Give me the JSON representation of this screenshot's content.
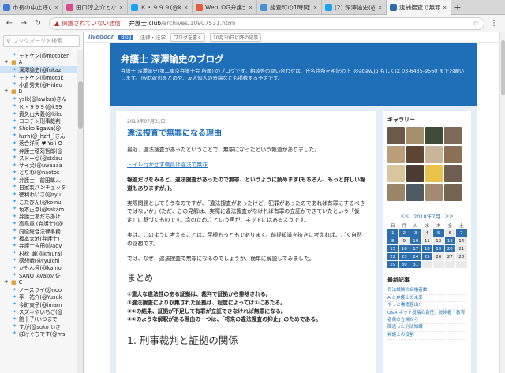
{
  "tabs": [
    {
      "label": "市長の中止呼びかけ",
      "color": "#3b7dd8"
    },
    {
      "label": "田口淳之介と小嶺麗",
      "color": "#d94b8c"
    },
    {
      "label": "Ｋ・９９９(@k999",
      "color": "#1da1f2"
    },
    {
      "label": "WebLOG弁護士中村",
      "color": "#e25d3a"
    },
    {
      "label": "能登町の1時間天気",
      "color": "#4a90d9"
    },
    {
      "label": "(2) 深澤諭史(@fuka",
      "color": "#1da1f2"
    },
    {
      "label": "逮捕捜査で無罪にな",
      "color": "#2b6cb0",
      "active": true
    },
    {
      "label": "+"
    }
  ],
  "nav": {
    "warning": "保護されていない通信",
    "host": "弁護士.club",
    "path": "/archives/10907531.html"
  },
  "sidebar": {
    "search_placeholder": "ブックマークを検索",
    "rows": [
      {
        "text": "モトケン(@motoken",
        "type": "item"
      },
      {
        "text": "A",
        "type": "folder"
      },
      {
        "text": "深澤諭史(@fukaz",
        "type": "item",
        "selected": true
      },
      {
        "text": "モトケン(@motok",
        "type": "item"
      },
      {
        "text": "小倉秀夫(@Hideo",
        "type": "item"
      },
      {
        "text": "B",
        "type": "folder"
      },
      {
        "text": "yslk(@lawkus)さん",
        "type": "item"
      },
      {
        "text": "Ｋ・９９９(@k99",
        "type": "item"
      },
      {
        "text": "資久山大義(@kiku",
        "type": "item"
      },
      {
        "text": "ヨコチン刑事裁判",
        "type": "item"
      },
      {
        "text": "Shoko Egawa(@",
        "type": "item"
      },
      {
        "text": "hzrh(@_hzrf_)さん",
        "type": "item"
      },
      {
        "text": "落合洋司 ♥ Yoji O",
        "type": "item"
      },
      {
        "text": "弁護士穂苅哲郎(@",
        "type": "item"
      },
      {
        "text": "スドー☺(@stdau",
        "type": "item"
      },
      {
        "text": "サイ犬(@uwaaaa",
        "type": "item"
      },
      {
        "text": "とりね(@naotos",
        "type": "item"
      },
      {
        "text": "弁護士　前田隼人",
        "type": "item"
      },
      {
        "text": "自家製パンチェッタ",
        "type": "item"
      },
      {
        "text": "徳利わいさ(@ryu",
        "type": "item"
      },
      {
        "text": "こたぴん(@koinuj",
        "type": "item"
      },
      {
        "text": "坂本正幸(@sakam",
        "type": "item"
      },
      {
        "text": "弁護士あだちあけ",
        "type": "item"
      },
      {
        "text": "高島章 (弁護士)(@",
        "type": "item"
      },
      {
        "text": "向原総合法律事務",
        "type": "item"
      },
      {
        "text": "橋本太地(弁護士)",
        "type": "item"
      },
      {
        "text": "弁護士吉田(@adv",
        "type": "item"
      },
      {
        "text": "村松 謙(@kmurai",
        "type": "item"
      },
      {
        "text": "感想戦(@ryuichi",
        "type": "item"
      },
      {
        "text": "かもん号(@kamo",
        "type": "item"
      },
      {
        "text": "SANO_Ayako/ 佐",
        "type": "item"
      },
      {
        "text": "C",
        "type": "folder"
      },
      {
        "text": "ノースライ(@noo",
        "type": "item"
      },
      {
        "text": "平　祐介(@Yusuk",
        "type": "item"
      },
      {
        "text": "今町東子(@imam",
        "type": "item"
      },
      {
        "text": "スズキやいちご(@",
        "type": "item"
      },
      {
        "text": "館十子(いつまで",
        "type": "item"
      },
      {
        "text": "すが(@suko_t)さ",
        "type": "item"
      },
      {
        "text": "ぽけぐちです(@ms",
        "type": "item"
      }
    ]
  },
  "livedoor": {
    "logo": "livedoor",
    "blog_tag": "Blog",
    "path": "法律・法学",
    "btn1": "ブログを書く",
    "btn2": "10月30日以降の記事"
  },
  "blog": {
    "title": "弁護士 深澤諭史のブログ",
    "desc": "弁護士 深澤諭史(第二東京弁護士会 所属) のブログです。相談等の問い合わせは、氏名住所を明記の上 i@atlaw.jp もしくは 03-6435-9560 までお願いします。Twitterのまとめや、友人知人の寄稿なども掲載する予定です。"
  },
  "post": {
    "date": "2018年07月31日",
    "title": "違法捜査で無罪になる理由",
    "p1": "最近、違法捜査があったということで、無罪になったという報道がありました。",
    "link": "トイレ行かせず職員は違法で無罪",
    "p2": "報道だけをみると、違法捜査があったので無罪、というように読めます(もちろん、もっと詳しい報道もありますが。)。",
    "p3": "実際問題としてそうなのですが、「違法捜査があったけど、犯罪があったのであれば有罪にするべきではないか」(ただ、この見解は、実際に違法捜査がなければ有罪の立証ができていたという「仮定」に基づくものです。念のため。) という声が、ネットにはあるようです。",
    "p4": "実は、このように考えることは、至極もっともであります。前提知識を抜きに考えれば、ごく自然の感想です。",
    "p5": "では、なぜ、違法捜査で無罪になるのでしょうか、簡単に解説してみました。",
    "h_summary": "まとめ",
    "summary": [
      "①重大な違法性のある証拠は、裁判で証拠から排除される。",
      "②違法捜査により収集された証拠は、程度によっては①にあたる。",
      "③①の結果、証拠が不足して有罪が立証できなければ無罪になる。",
      "④①のような解釈がある理由の一つは、「将来の違法捜査の抑止」のためである。"
    ],
    "h_section1": "1. 刑事裁判と証拠の関係"
  },
  "side": {
    "gallery_title": "ギャラリー",
    "gallery_colors": [
      "#6b5a4a",
      "#a88f6c",
      "#3e4b3a",
      "#7d6b57",
      "#b9a07a",
      "#5d4636",
      "#c8b59a",
      "#8a7055",
      "#d8c69e",
      "#4b3d33",
      "#e8c24a",
      "#6f5f52",
      "#9c8468",
      "#4e5b62",
      "#a38b73",
      "#756452"
    ],
    "cal_title": "2018年7月",
    "cal_prev": "<<",
    "cal_next": ">>",
    "dow": [
      "日",
      "月",
      "火",
      "水",
      "木",
      "金",
      "土"
    ],
    "days": [
      {
        "d": "1",
        "has": true
      },
      {
        "d": "2",
        "has": true
      },
      {
        "d": "3",
        "has": true
      },
      {
        "d": "4",
        "has": false
      },
      {
        "d": "5",
        "has": true
      },
      {
        "d": "6",
        "has": false
      },
      {
        "d": "7",
        "has": true
      },
      {
        "d": "8",
        "has": true
      },
      {
        "d": "9",
        "has": false
      },
      {
        "d": "10",
        "has": true
      },
      {
        "d": "11",
        "has": false
      },
      {
        "d": "12",
        "has": false
      },
      {
        "d": "13",
        "has": true
      },
      {
        "d": "14",
        "has": false
      },
      {
        "d": "15",
        "has": true
      },
      {
        "d": "16",
        "has": true
      },
      {
        "d": "17",
        "has": true
      },
      {
        "d": "18",
        "has": true
      },
      {
        "d": "19",
        "has": true
      },
      {
        "d": "20",
        "has": true
      },
      {
        "d": "21",
        "has": false
      },
      {
        "d": "22",
        "has": true
      },
      {
        "d": "23",
        "has": true
      },
      {
        "d": "24",
        "has": true
      },
      {
        "d": "25",
        "has": true
      },
      {
        "d": "26",
        "has": false
      },
      {
        "d": "27",
        "has": false
      },
      {
        "d": "28",
        "has": false
      },
      {
        "d": "29",
        "has": true
      },
      {
        "d": "30",
        "has": true
      },
      {
        "d": "31",
        "has": true
      },
      {
        "d": "",
        "has": false
      },
      {
        "d": "",
        "has": false
      },
      {
        "d": "",
        "has": false
      },
      {
        "d": "",
        "has": false
      }
    ],
    "recent_title": "最新記事",
    "recent": [
      "司法試験の合格者数",
      "AIと弁護士の未来",
      "やっと書籍届出!",
      "Q&A:ネット投稿の責任、技術者・教育者側の立場から",
      "間違った刑法知識",
      "弁護士の役割"
    ]
  }
}
